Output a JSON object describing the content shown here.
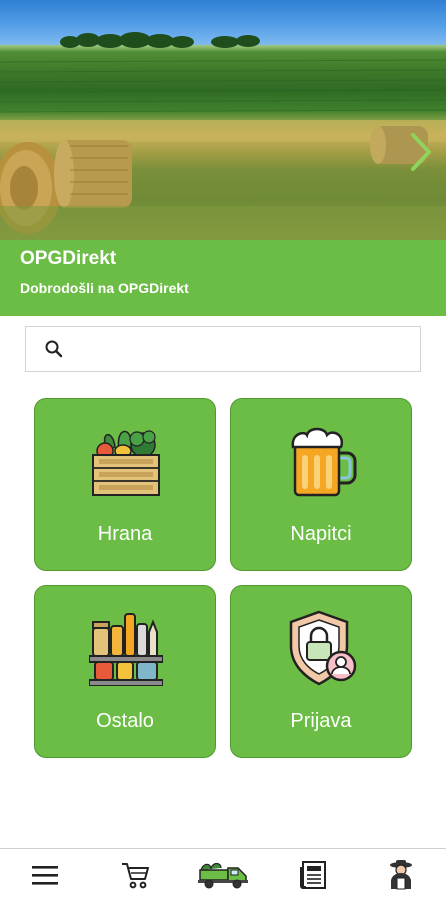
{
  "hero": {
    "icons": {
      "next": "chevron-right-icon"
    }
  },
  "header": {
    "title": "OPGDirekt",
    "subtitle": "Dobrodošli na OPGDirekt"
  },
  "search": {
    "placeholder": "",
    "value": "",
    "icon": "search-icon"
  },
  "categories": [
    {
      "label": "Hrana",
      "icon": "vegetable-crate-icon"
    },
    {
      "label": "Napitci",
      "icon": "beer-mug-icon"
    },
    {
      "label": "Ostalo",
      "icon": "pantry-shelf-icon"
    },
    {
      "label": "Prijava",
      "icon": "user-shield-icon"
    }
  ],
  "bottom_nav": [
    {
      "icon": "menu-icon"
    },
    {
      "icon": "cart-icon"
    },
    {
      "icon": "farm-truck-icon",
      "active": true
    },
    {
      "icon": "newspaper-icon"
    },
    {
      "icon": "farmer-profile-icon"
    }
  ],
  "colors": {
    "brand_green": "#6cbd45",
    "tile_border": "#4f9a2f",
    "text_on_green": "#ffffff"
  }
}
